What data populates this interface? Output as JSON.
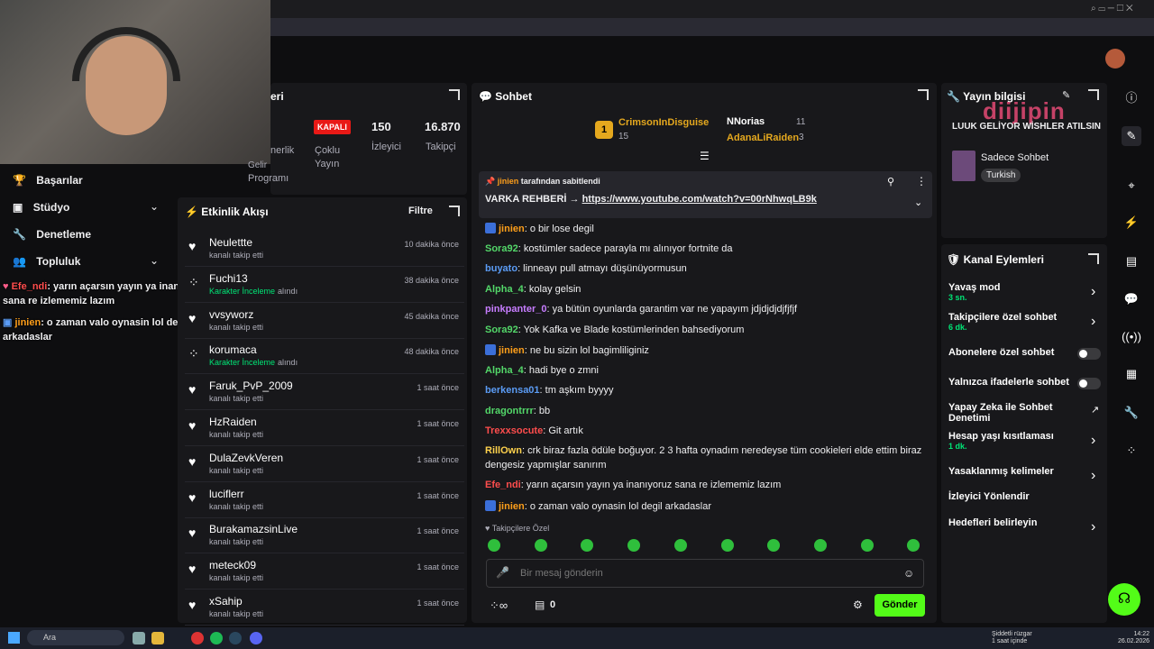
{
  "overlay": {
    "sidebar_items": [
      "Başarılar",
      "Stüdyo",
      "Denetleme",
      "Topluluk"
    ],
    "msg1_user": "Efe_ndi",
    "msg1_text": ": yarın açarsın yayın ya inanıyoruz sana re izlememiz lazım",
    "msg2_user": "jinien",
    "msg2_text": ": o zaman valo oynasin lol degil arkadaslar"
  },
  "stats": {
    "partial_title": "eri",
    "monetize_lbl1": "Gelir",
    "monetize_lbl2": "Programı",
    "monetize_lbl0": "nerlik",
    "status_badge": "KAPALI",
    "status_label1": "Çoklu",
    "status_label2": "Yayın",
    "viewers_value": "150",
    "viewers_label": "İzleyici",
    "followers_value": "16.870",
    "followers_label": "Takipçi"
  },
  "feed": {
    "title": "Etkinlik Akışı",
    "filter": "Filtre",
    "items": [
      {
        "name": "Neulettte",
        "sub": "kanalı takip etti",
        "time": "10 dakika önce",
        "type": "follow"
      },
      {
        "name": "Fuchi13",
        "sub": "Karakter İnceleme",
        "sub2": "alındı",
        "time": "38 dakika önce",
        "type": "reward"
      },
      {
        "name": "vvsyworz",
        "sub": "kanalı takip etti",
        "time": "45 dakika önce",
        "type": "follow"
      },
      {
        "name": "korumaca",
        "sub": "Karakter İnceleme",
        "sub2": "alındı",
        "time": "48 dakika önce",
        "type": "reward"
      },
      {
        "name": "Faruk_PvP_2009",
        "sub": "kanalı takip etti",
        "time": "1 saat önce",
        "type": "follow"
      },
      {
        "name": "HzRaiden",
        "sub": "kanalı takip etti",
        "time": "1 saat önce",
        "type": "follow"
      },
      {
        "name": "DulaZevkVeren",
        "sub": "kanalı takip etti",
        "time": "1 saat önce",
        "type": "follow"
      },
      {
        "name": "luciflerr",
        "sub": "kanalı takip etti",
        "time": "1 saat önce",
        "type": "follow"
      },
      {
        "name": "BurakamazsinLive",
        "sub": "kanalı takip etti",
        "time": "1 saat önce",
        "type": "follow"
      },
      {
        "name": "meteck09",
        "sub": "kanalı takip etti",
        "time": "1 saat önce",
        "type": "follow"
      },
      {
        "name": "xSahip",
        "sub": "kanalı takip etti",
        "time": "1 saat önce",
        "type": "follow"
      }
    ]
  },
  "chat": {
    "title": "Sohbet",
    "top1_name": "CrimsonInDisguise",
    "top1_score": "15",
    "top1_rank": "1",
    "top2_name": "NNorias",
    "top2_score": "11",
    "top3_name": "AdanaLiRaiden",
    "top3_score": "3",
    "pinned_by": "jinien",
    "pinned_suffix": "tarafından sabitlendi",
    "pinned_text": "VARKA REHBERİ →",
    "pinned_link": "https://www.youtube.com/watch?v=00rNhwqLB9k",
    "messages": [
      {
        "user": "jinien",
        "color": "#ff9f1a",
        "text": ": o bir lose degil"
      },
      {
        "user": "Sora92",
        "color": "#53d769",
        "text": ": kostümler sadece parayla mı alınıyor fortnite da"
      },
      {
        "user": "buyato",
        "color": "#5b9cf5",
        "text": ": linneayı pull atmayı düşünüyormusun"
      },
      {
        "user": "Alpha_4",
        "color": "#53d769",
        "text": ": kolay gelsin"
      },
      {
        "user": "pinkpanter_0",
        "color": "#c77dff",
        "text": ": ya bütün oyunlarda garantim var ne yapayım jdjdjdjdjfjfjf"
      },
      {
        "user": "Sora92",
        "color": "#53d769",
        "text": ": Yok Kafka ve Blade kostümlerinden bahsediyorum"
      },
      {
        "user": "jinien",
        "color": "#ff9f1a",
        "text": ": ne bu sizin lol bagimliliginiz"
      },
      {
        "user": "Alpha_4",
        "color": "#53d769",
        "text": ": hadi bye o zmni"
      },
      {
        "user": "berkensa01",
        "color": "#5b9cf5",
        "text": ": tm aşkım byyyy"
      },
      {
        "user": "dragontrrr",
        "color": "#53d769",
        "text": ": bb"
      },
      {
        "user": "Trexxsocute",
        "color": "#ff4d4d",
        "text": ": Git artık"
      },
      {
        "user": "RillOwn",
        "color": "#ffd24d",
        "text": ": crk biraz fazla ödüle boğuyor. 2 3 hafta oynadım neredeyse tüm cookieleri elde ettim biraz"
      },
      {
        "user": "",
        "color": "#efeff1",
        "text": "dengesiz yapmışlar sanırım"
      },
      {
        "user": "Efe_ndi",
        "color": "#ff4d4d",
        "text": ": yarın açarsın yayın ya inanıyoruz sana re izlememiz lazım"
      },
      {
        "user": "jinien",
        "color": "#ff9f1a",
        "text": ": o zaman valo oynasin lol degil arkadaslar"
      }
    ],
    "followers_only": "Takipçilere Özel",
    "input_placeholder": "Bir mesaj gönderin",
    "points_value": "0",
    "send_label": "Gönder"
  },
  "stream_info": {
    "title": "Yayın bilgisi",
    "stream_title": "LUUK GELİYOR WİSHLER ATILSIN",
    "category": "Sadece Sohbet",
    "tag": "Turkish",
    "watermark": "diijipin"
  },
  "actions": {
    "title": "Kanal Eylemleri",
    "items": [
      {
        "label": "Yavaş mod",
        "sub": "3 sn.",
        "kind": "chevron"
      },
      {
        "label": "Takipçilere özel sohbet",
        "sub": "6 dk.",
        "kind": "chevron"
      },
      {
        "label": "Abonelere özel sohbet",
        "sub": "",
        "kind": "toggle"
      },
      {
        "label": "Yalnızca ifadelerle sohbet",
        "sub": "",
        "kind": "toggle"
      },
      {
        "label": "Yapay Zeka ile Sohbet Denetimi",
        "sub": "",
        "kind": "external"
      },
      {
        "label": "Hesap yaşı kısıtlaması",
        "sub": "1 dk.",
        "kind": "chevron"
      },
      {
        "label": "Yasaklanmış kelimeler",
        "sub": "",
        "kind": "chevron"
      },
      {
        "label": "İzleyici Yönlendir",
        "sub": "",
        "kind": "none"
      },
      {
        "label": "Hedefleri belirleyin",
        "sub": "",
        "kind": "chevron"
      }
    ]
  },
  "taskbar": {
    "search": "Ara",
    "weather1": "Şiddetli rüzgar",
    "weather2": "1 saat içinde",
    "time": "14:22",
    "date": "26.02.2026"
  }
}
